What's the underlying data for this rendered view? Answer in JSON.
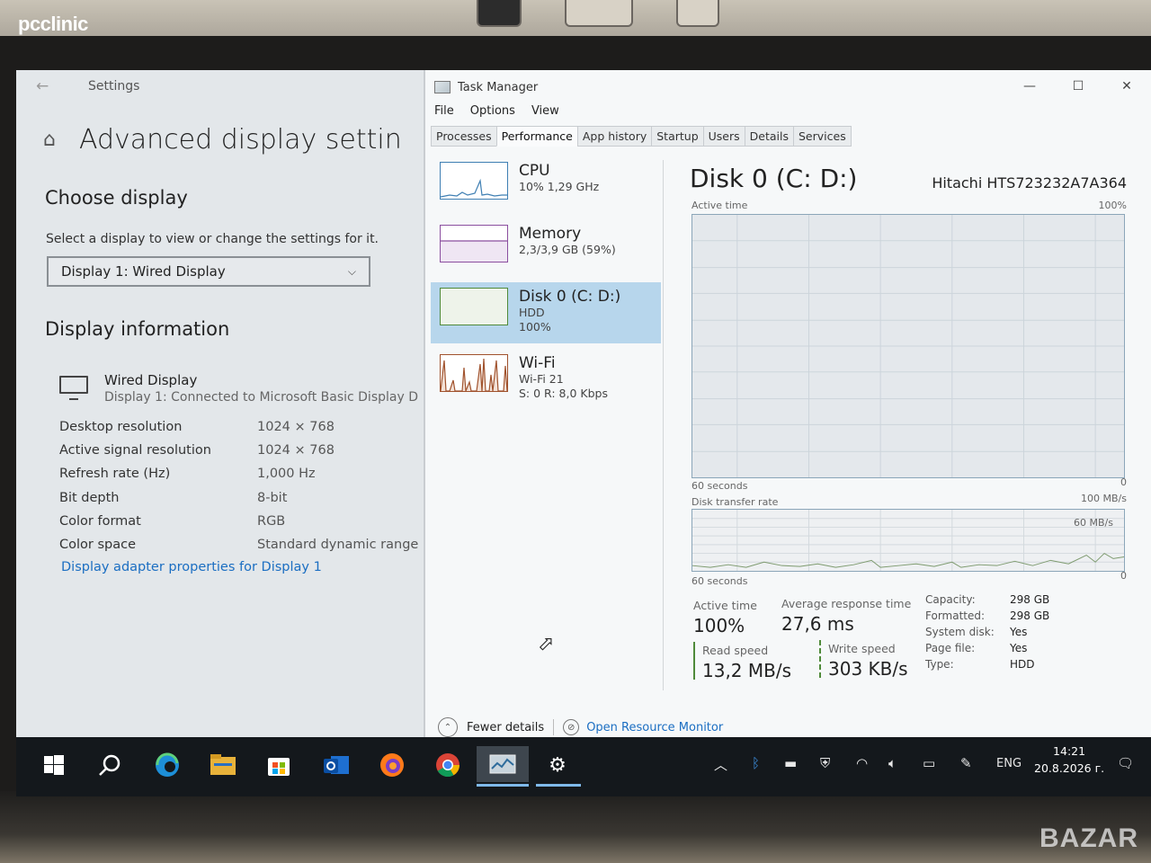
{
  "photo": {
    "brand": "pcclinic",
    "watermark": "BAZAR"
  },
  "settings": {
    "window_title": "Settings",
    "page_title": "Advanced display settin",
    "choose_display_heading": "Choose display",
    "choose_display_help": "Select a display to view or change the settings for it.",
    "display_selected": "Display 1: Wired Display",
    "display_info_heading": "Display information",
    "monitor_name": "Wired Display",
    "monitor_desc": "Display 1: Connected to Microsoft Basic Display D",
    "info": [
      {
        "key": "Desktop resolution",
        "value": "1024 × 768"
      },
      {
        "key": "Active signal resolution",
        "value": "1024 × 768"
      },
      {
        "key": "Refresh rate (Hz)",
        "value": "1,000 Hz"
      },
      {
        "key": "Bit depth",
        "value": "8-bit"
      },
      {
        "key": "Color format",
        "value": "RGB"
      },
      {
        "key": "Color space",
        "value": "Standard dynamic range"
      }
    ],
    "adapter_link": "Display adapter properties for Display 1"
  },
  "task_manager": {
    "window_title": "Task Manager",
    "menu": [
      "File",
      "Options",
      "View"
    ],
    "tabs": [
      "Processes",
      "Performance",
      "App history",
      "Startup",
      "Users",
      "Details",
      "Services"
    ],
    "active_tab": "Performance",
    "resources": [
      {
        "name": "CPU",
        "line1": "10%  1,29 GHz",
        "line2": ""
      },
      {
        "name": "Memory",
        "line1": "2,3/3,9 GB (59%)",
        "line2": ""
      },
      {
        "name": "Disk 0 (C: D:)",
        "line1": "HDD",
        "line2": "100%"
      },
      {
        "name": "Wi-Fi",
        "line1": "Wi-Fi 21",
        "line2": "S: 0  R: 8,0 Kbps"
      }
    ],
    "disk": {
      "title": "Disk 0 (C: D:)",
      "model": "Hitachi HTS723232A7A364",
      "active_time_label": "Active time",
      "active_time_max": "100%",
      "active_time_min": "0",
      "seconds_label": "60 seconds",
      "transfer_label": "Disk transfer rate",
      "transfer_max": "100 MB/s",
      "transfer_mid": "60 MB/s",
      "transfer_min": "0",
      "stats": {
        "active_time_title": "Active time",
        "active_time_value": "100%",
        "avg_response_title": "Average response time",
        "avg_response_value": "27,6 ms",
        "read_title": "Read speed",
        "read_value": "13,2 MB/s",
        "write_title": "Write speed",
        "write_value": "303 KB/s"
      },
      "props": [
        {
          "key": "Capacity:",
          "value": "298 GB"
        },
        {
          "key": "Formatted:",
          "value": "298 GB"
        },
        {
          "key": "System disk:",
          "value": "Yes"
        },
        {
          "key": "Page file:",
          "value": "Yes"
        },
        {
          "key": "Type:",
          "value": "HDD"
        }
      ]
    },
    "fewer_details": "Fewer details",
    "open_resource_monitor": "Open Resource Monitor"
  },
  "taskbar": {
    "language": "ENG",
    "time": "14:21",
    "date": "20.8.2026 г."
  },
  "colors": {
    "accent": "#1b6ec2",
    "selected_resource": "#b7d6ec",
    "graph_border": "#8ba6b9",
    "wifi_graph": "#a0522d"
  }
}
